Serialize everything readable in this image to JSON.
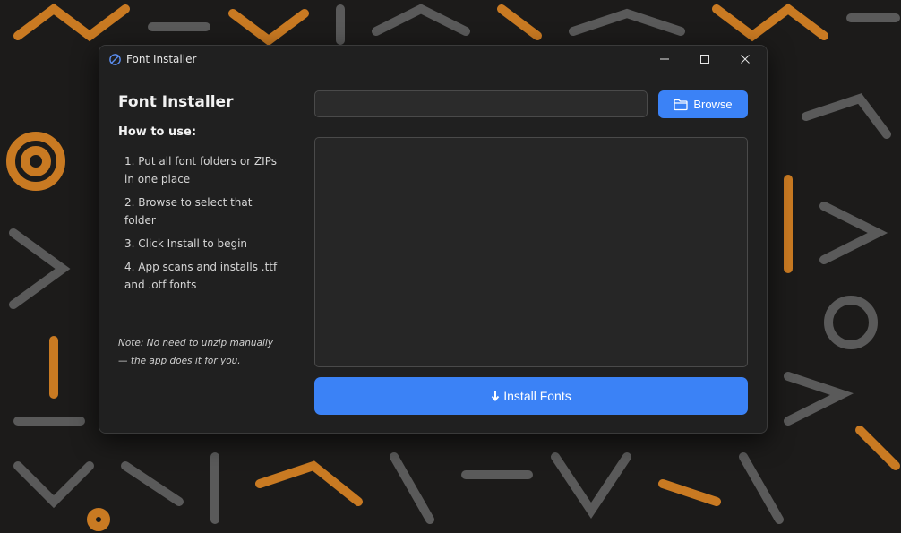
{
  "window": {
    "title": "Font Installer",
    "controls": [
      "minimize-icon",
      "maximize-icon",
      "close-icon"
    ]
  },
  "sidebar": {
    "title": "Font Installer",
    "howto_heading": "How to use:",
    "steps": [
      "1.  Put all font folders or ZIPs in one place",
      "2.  Browse to select that folder",
      "3.  Click Install to begin",
      "4.  App scans and installs .ttf and .otf fonts"
    ],
    "note": "Note: No need to unzip manually — the app does it for you."
  },
  "main": {
    "folder_path": "",
    "browse_label": "Browse",
    "browse_icon": "folder-icon",
    "log_text": "",
    "install_label": "Install Fonts",
    "install_icon": "download-arrow-icon"
  },
  "colors": {
    "accent": "#3b82f6",
    "window_bg": "#202020",
    "input_bg": "#2b2b2b",
    "border": "#4a4a4a",
    "wallpaper_dark": "#1c1b1a",
    "wallpaper_orange": "#c97a22",
    "wallpaper_gray": "#5a5a5a"
  }
}
